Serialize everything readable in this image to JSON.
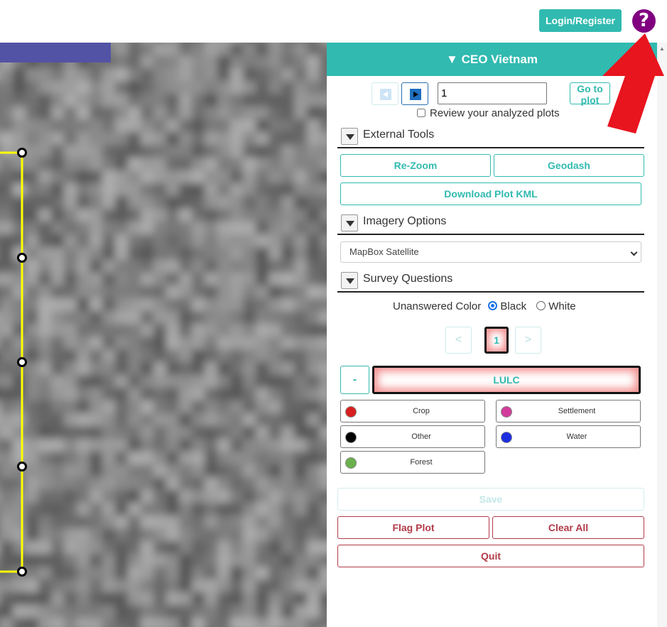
{
  "topbar": {
    "login_label": "Login/Register",
    "help_glyph": "?"
  },
  "panel": {
    "title": "▼ CEO Vietnam",
    "plot_number": "1",
    "goto_label": "Go to plot",
    "review_label": "Review your analyzed plots",
    "sections": {
      "external_tools": "External Tools",
      "imagery_options": "Imagery Options",
      "survey_questions": "Survey Questions"
    },
    "tools": {
      "rezoom": "Re-Zoom",
      "geodash": "Geodash",
      "download_kml": "Download Plot KML"
    },
    "imagery": {
      "selected": "MapBox Satellite"
    },
    "unanswered_color": {
      "label": "Unanswered Color",
      "options": [
        "Black",
        "White"
      ],
      "selected": "Black"
    },
    "pager": {
      "prev": "<",
      "current": "1",
      "next": ">"
    },
    "question": {
      "collapse_label": "-",
      "title": "LULC",
      "answers": [
        {
          "label": "Crop",
          "color": "#d81e1e"
        },
        {
          "label": "Settlement",
          "color": "#d23c9a"
        },
        {
          "label": "Other",
          "color": "#000000"
        },
        {
          "label": "Water",
          "color": "#1d2ee0"
        },
        {
          "label": "Forest",
          "color": "#6ab04c"
        }
      ]
    },
    "actions": {
      "save": "Save",
      "flag": "Flag Plot",
      "clear": "Clear All",
      "quit": "Quit"
    }
  },
  "colors": {
    "accent": "#31bab0",
    "danger": "#b23a48",
    "plot_outline": "#ffff00",
    "help": "#800080",
    "arrow": "#e8141e"
  }
}
